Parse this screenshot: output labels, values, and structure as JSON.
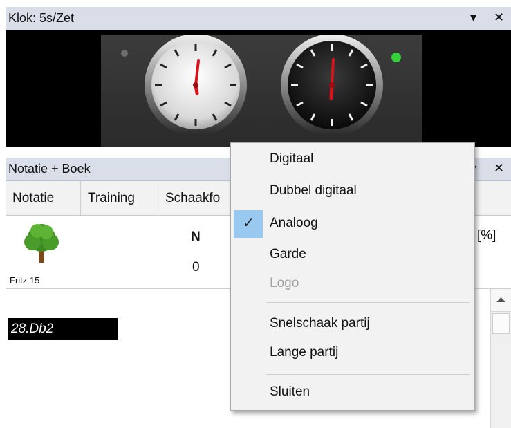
{
  "clock_panel": {
    "title": "Klok: 5s/Zet",
    "dropdown_glyph": "▾",
    "close_glyph": "✕"
  },
  "notation_panel": {
    "title": "Notatie + Boek",
    "dropdown_glyph": "▾",
    "close_glyph": "✕",
    "tabs": [
      "Notatie",
      "Training",
      "Schaakfo"
    ]
  },
  "info": {
    "engine_name": "Fritz 15",
    "col_n_header": "N",
    "col_n_value": "0",
    "col_percent_header": "[%]"
  },
  "notation": {
    "current_move": "28.Db2"
  },
  "context_menu": {
    "items": [
      {
        "label": "Digitaal"
      },
      {
        "label": "Dubbel digitaal"
      },
      {
        "label": "Analoog",
        "checked": true
      },
      {
        "label": "Garde"
      },
      {
        "label": "Logo",
        "disabled": true
      },
      {
        "label": "Snelschaak partij"
      },
      {
        "label": "Lange partij"
      },
      {
        "label": "Sluiten"
      }
    ],
    "check_glyph": "✓"
  },
  "colors": {
    "titlebar_bg": "#d9dee8",
    "check_highlight": "#99c9ef",
    "active_led": "#35d03a",
    "clock_hand": "#d8141a"
  }
}
